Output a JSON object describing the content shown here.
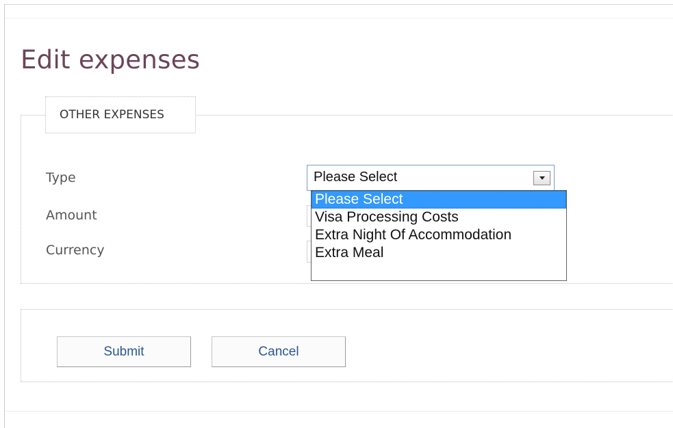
{
  "page": {
    "title": "Edit expenses"
  },
  "form": {
    "section_legend": "OTHER EXPENSES",
    "fields": {
      "type_label": "Type",
      "amount_label": "Amount",
      "currency_label": "Currency"
    },
    "type_select": {
      "selected_value": "Please Select",
      "options": [
        "Please Select",
        "Visa Processing Costs",
        "Extra Night Of Accommodation",
        "Extra Meal"
      ],
      "highlighted_index": 0
    }
  },
  "actions": {
    "submit_label": "Submit",
    "cancel_label": "Cancel"
  },
  "colors": {
    "title": "#6b4558",
    "button_text": "#2a5693",
    "option_highlight": "#3399ff"
  }
}
